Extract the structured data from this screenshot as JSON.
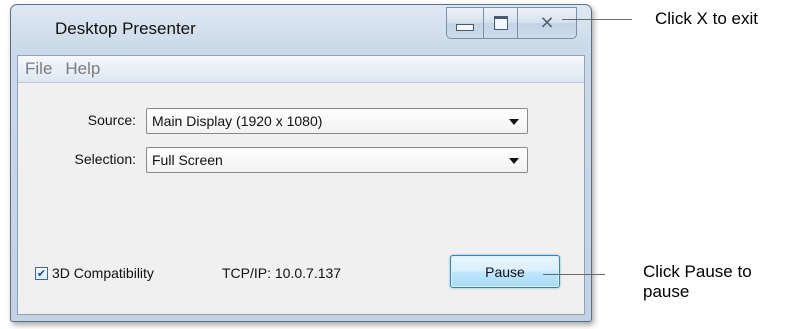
{
  "window": {
    "title": "Desktop Presenter",
    "controls": {
      "minimize_icon": "minimize-icon",
      "maximize_icon": "maximize-icon",
      "close_icon": "close-icon",
      "close_glyph": "⨯"
    }
  },
  "menubar": {
    "items": [
      {
        "label": "File"
      },
      {
        "label": "Help"
      }
    ]
  },
  "form": {
    "source": {
      "label": "Source:",
      "value": "Main Display (1920 x 1080)"
    },
    "selection": {
      "label": "Selection:",
      "value": "Full Screen"
    }
  },
  "footer": {
    "compat_checkbox": {
      "label": "3D Compatibility",
      "checked": true,
      "check_glyph": "✔"
    },
    "tcp_text": "TCP/IP: 10.0.7.137",
    "pause_label": "Pause"
  },
  "annotations": {
    "exit_note": "Click X to exit",
    "pause_note": "Click Pause to pause"
  },
  "colors": {
    "accent": "#3c7fb1",
    "titlebar": "#cbd9e8",
    "menu_text": "#7c7c7c"
  }
}
